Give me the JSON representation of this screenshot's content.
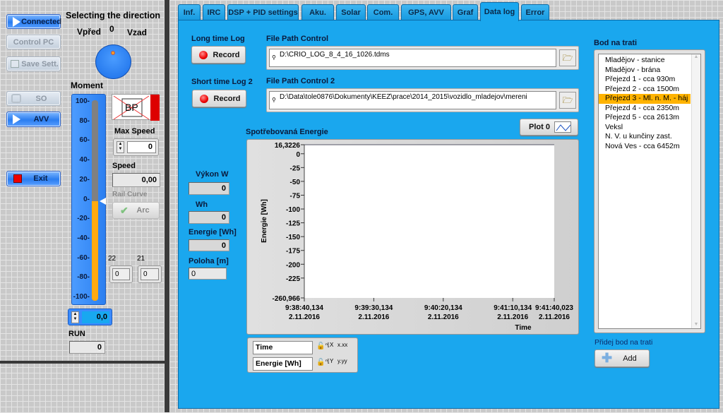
{
  "left": {
    "buttons": {
      "connected": "Connected",
      "control_pc": "Control  PC",
      "save": "Save Sett.",
      "so": "SO",
      "avv": "AVV",
      "exit": "Exit"
    },
    "direction": {
      "title": "Selecting the direction",
      "forward": "Vpřed",
      "zero": "0",
      "backward": "Vzad"
    },
    "moment": {
      "label": "Moment",
      "ticks": [
        "100",
        "80",
        "60",
        "40",
        "20",
        "0",
        "-20",
        "-40",
        "-60",
        "-80",
        "-100"
      ],
      "value": 0,
      "value_text": "0,0",
      "fill_color": "#ffaa10"
    },
    "run": {
      "label": "RUN",
      "value": "0"
    },
    "bp": "BP",
    "max_speed": {
      "label": "Max Speed",
      "value": "0"
    },
    "speed": {
      "label": "Speed",
      "value": "0,00"
    },
    "rail_curve": {
      "label": "Rail Curve",
      "button": "Arc"
    },
    "ind22": {
      "label": "22",
      "value": "0"
    },
    "ind21": {
      "label": "21",
      "value": "0"
    }
  },
  "tabs": [
    {
      "label": "Inf."
    },
    {
      "label": "IRC"
    },
    {
      "label": "DSP + PID settings"
    },
    {
      "label": "Aku."
    },
    {
      "label": "Solar"
    },
    {
      "label": "Com."
    },
    {
      "label": "GPS, AVV"
    },
    {
      "label": "Graf"
    },
    {
      "label": "Data log",
      "active": true
    },
    {
      "label": "Error"
    }
  ],
  "datalog": {
    "long_log": {
      "label": "Long time Log",
      "button": "Record"
    },
    "short_log": {
      "label": "Short time Log 2",
      "button": "Record"
    },
    "path1": {
      "label": "File Path Control",
      "value": "D:\\CRIO_LOG_8_4_16_1026.tdms"
    },
    "path2": {
      "label": "File Path Control 2",
      "value": "D:\\Data\\tole0876\\Dokumenty\\KEEZ\\prace\\2014_2015\\vozidlo_mladejov\\mereni"
    },
    "plot_legend": "Plot 0",
    "vykon": {
      "label": "Výkon W",
      "value": "0"
    },
    "wh": {
      "label": "Wh",
      "value": "0"
    },
    "energie": {
      "label": "Energie [Wh]",
      "value": "0"
    },
    "poloha": {
      "label": "Poloha [m]",
      "value": "0"
    },
    "scale_legend": {
      "x": "Time",
      "y": "Energie [Wh]"
    },
    "track": {
      "label": "Bod na trati",
      "items": [
        "Mladějov - stanice",
        "Mladějov - brána",
        "Přejezd 1 - cca 930m",
        "Přejezd 2 - cca 1500m",
        "Přejezd 3 - Ml. n. M. - háj",
        "Přejezd 4 -  cca 2350m",
        "Přejezd 5 - cca 2613m",
        "Veksl",
        "N. V. u kunčiny zast.",
        "Nová Ves - cca 6452m"
      ],
      "selected": 4,
      "selected_color": "#ffb300"
    },
    "add": {
      "label": "Přidej bod na trati",
      "button": "Add"
    }
  },
  "chart_data": {
    "type": "line",
    "title": "Spotřebovaná Energie",
    "xlabel": "Time",
    "ylabel": "Energie [Wh]",
    "ylim": [
      -260.966,
      16.3226
    ],
    "yticks": [
      {
        "v": 16.3226,
        "t": "16,3226"
      },
      {
        "v": 0,
        "t": "0"
      },
      {
        "v": -25,
        "t": "-25"
      },
      {
        "v": -50,
        "t": "-50"
      },
      {
        "v": -75,
        "t": "-75"
      },
      {
        "v": -100,
        "t": "-100"
      },
      {
        "v": -125,
        "t": "-125"
      },
      {
        "v": -150,
        "t": "-150"
      },
      {
        "v": -175,
        "t": "-175"
      },
      {
        "v": -200,
        "t": "-200"
      },
      {
        "v": -225,
        "t": "-225"
      },
      {
        "v": -260.966,
        "t": "-260,966"
      }
    ],
    "xlim": [
      "9:38:40,134 2.11.2016",
      "9:41:40,023 2.11.2016"
    ],
    "xticks": [
      {
        "s": 0,
        "t": "9:38:40,134",
        "d": "2.11.2016"
      },
      {
        "s": 50,
        "t": "9:39:30,134",
        "d": "2.11.2016"
      },
      {
        "s": 100,
        "t": "9:40:20,134",
        "d": "2.11.2016"
      },
      {
        "s": 150,
        "t": "9:41:10,134",
        "d": "2.11.2016"
      },
      {
        "s": 179.889,
        "t": "9:41:40,023",
        "d": "2.11.2016"
      }
    ],
    "series": [
      {
        "name": "Plot 0",
        "values": []
      }
    ],
    "grid": false
  }
}
